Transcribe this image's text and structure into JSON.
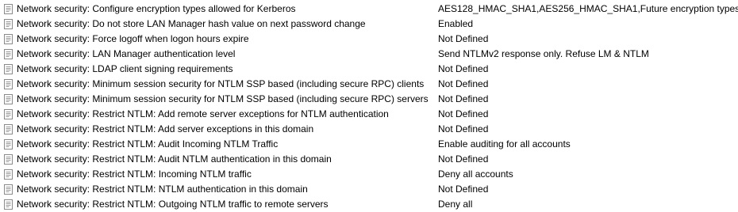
{
  "policy_list": {
    "icon": "policy-document-icon",
    "rows": [
      {
        "policy": "Network security: Configure encryption types allowed for Kerberos",
        "setting": "AES128_HMAC_SHA1,AES256_HMAC_SHA1,Future encryption types"
      },
      {
        "policy": "Network security: Do not store LAN Manager hash value on next password change",
        "setting": "Enabled"
      },
      {
        "policy": "Network security: Force logoff when logon hours expire",
        "setting": "Not Defined"
      },
      {
        "policy": "Network security: LAN Manager authentication level",
        "setting": "Send NTLMv2 response only. Refuse LM & NTLM"
      },
      {
        "policy": "Network security: LDAP client signing requirements",
        "setting": "Not Defined"
      },
      {
        "policy": "Network security: Minimum session security for NTLM SSP based (including secure RPC) clients",
        "setting": "Not Defined"
      },
      {
        "policy": "Network security: Minimum session security for NTLM SSP based (including secure RPC) servers",
        "setting": "Not Defined"
      },
      {
        "policy": "Network security: Restrict NTLM: Add remote server exceptions for NTLM authentication",
        "setting": "Not Defined"
      },
      {
        "policy": "Network security: Restrict NTLM: Add server exceptions in this domain",
        "setting": "Not Defined"
      },
      {
        "policy": "Network security: Restrict NTLM: Audit Incoming NTLM Traffic",
        "setting": "Enable auditing for all accounts"
      },
      {
        "policy": "Network security: Restrict NTLM: Audit NTLM authentication in this domain",
        "setting": "Not Defined"
      },
      {
        "policy": "Network security: Restrict NTLM: Incoming NTLM traffic",
        "setting": "Deny all accounts"
      },
      {
        "policy": "Network security: Restrict NTLM: NTLM authentication in this domain",
        "setting": "Not Defined"
      },
      {
        "policy": "Network security: Restrict NTLM: Outgoing NTLM traffic to remote servers",
        "setting": "Deny all"
      }
    ]
  }
}
